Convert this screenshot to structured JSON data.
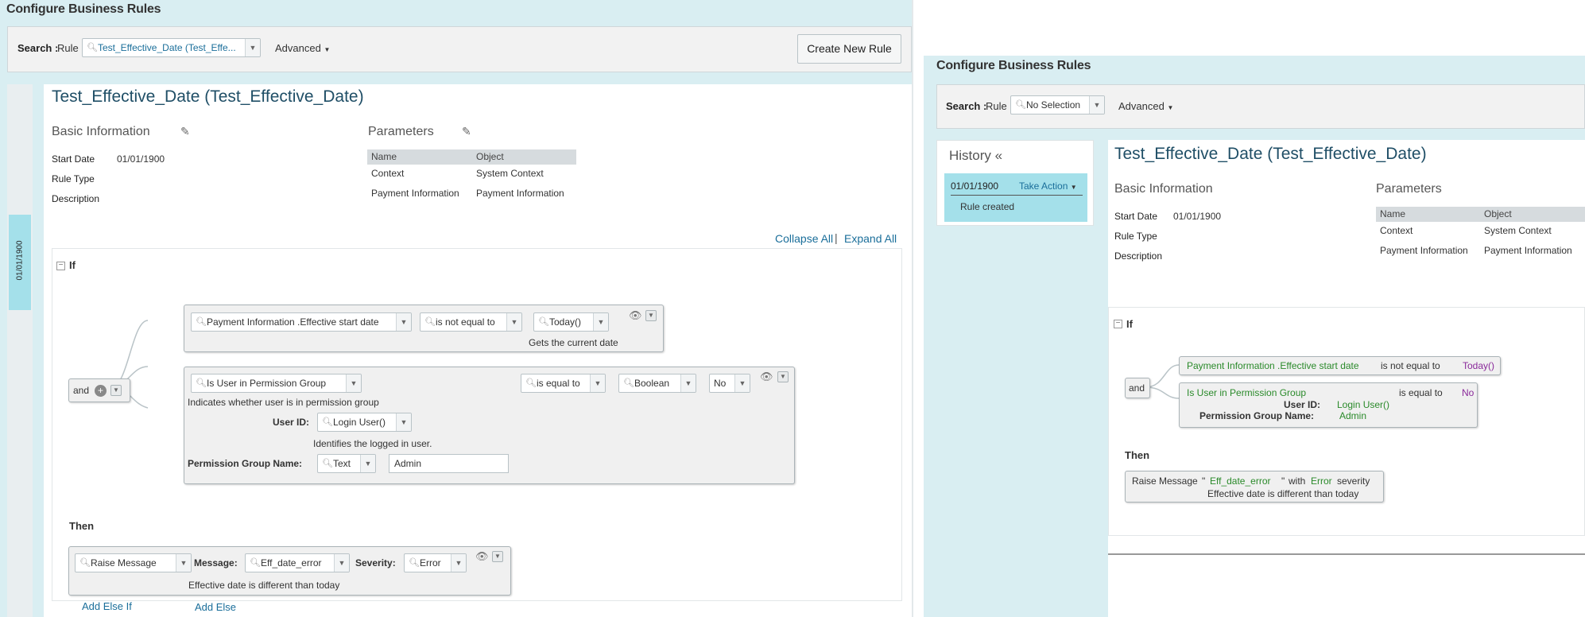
{
  "left": {
    "page_title": "Configure Business Rules",
    "search": {
      "label": "Search :",
      "sublabel": "Rule",
      "value": "Test_Effective_Date (Test_Effe...",
      "advanced": "Advanced",
      "create_button": "Create New Rule"
    },
    "history_date": "01/01/1900",
    "rule_title": "Test_Effective_Date (Test_Effective_Date)",
    "basic_info": {
      "heading": "Basic Information",
      "start_date_label": "Start Date",
      "start_date": "01/01/1900",
      "rule_type_label": "Rule Type",
      "description_label": "Description"
    },
    "parameters": {
      "heading": "Parameters",
      "col_name": "Name",
      "col_object": "Object",
      "rows": [
        {
          "name": "Context",
          "object": "System Context"
        },
        {
          "name": "Payment Information",
          "object": "Payment Information"
        }
      ]
    },
    "collapse_all": "Collapse All",
    "expand_all": "Expand All",
    "separator": "|",
    "if_label": "If",
    "and_label": "and",
    "cond1": {
      "field": "Payment Information .Effective start date",
      "operator": "is not equal to",
      "value": "Today()",
      "desc": "Gets the current date"
    },
    "cond2": {
      "field": "Is User in Permission Group",
      "desc": "Indicates whether user is in permission group",
      "operator": "is equal to",
      "type": "Boolean",
      "value": "No",
      "userid_label": "User ID:",
      "userid_value": "Login User()",
      "userid_desc": "Identifies the logged in user.",
      "pgn_label": "Permission Group Name:",
      "pgn_type": "Text",
      "pgn_value": "Admin"
    },
    "then_label": "Then",
    "action": {
      "type": "Raise Message",
      "message_label": "Message:",
      "message_value": "Eff_date_error",
      "severity_label": "Severity:",
      "severity_value": "Error",
      "desc": "Effective date is different than today"
    },
    "add_else_if": "Add Else If",
    "add_else": "Add Else"
  },
  "right": {
    "page_title": "Configure Business Rules",
    "search": {
      "label": "Search :",
      "sublabel": "Rule",
      "value": "No Selection",
      "advanced": "Advanced"
    },
    "history": {
      "title": "History «",
      "date": "01/01/1900",
      "take_action": "Take Action",
      "event": "Rule created"
    },
    "rule_title": "Test_Effective_Date (Test_Effective_Date)",
    "basic_info": {
      "heading": "Basic Information",
      "start_date_label": "Start Date",
      "start_date": "01/01/1900",
      "rule_type_label": "Rule Type",
      "description_label": "Description"
    },
    "parameters": {
      "heading": "Parameters",
      "col_name": "Name",
      "col_object": "Object",
      "rows": [
        {
          "name": "Context",
          "object": "System Context"
        },
        {
          "name": "Payment Information",
          "object": "Payment Information"
        }
      ]
    },
    "if_label": "If",
    "and_label": "and",
    "cond1": {
      "field": "Payment Information .Effective start date",
      "operator": "is not equal to",
      "value": "Today()"
    },
    "cond2": {
      "field": "Is User in Permission Group",
      "operator": "is equal to",
      "value": "No",
      "userid_label": "User ID:",
      "userid_value": "Login User()",
      "pgn_label": "Permission Group Name:",
      "pgn_value": "Admin"
    },
    "then_label": "Then",
    "action": {
      "type": "Raise Message",
      "quote_open": "\"",
      "message": "Eff_date_error",
      "quote_close": "\"",
      "with": "with",
      "severity": "Error",
      "severity_suffix": "severity",
      "desc": "Effective date is different than today"
    }
  },
  "colors": {
    "panel_bg": "#d9eef2",
    "link": "#1a6e9a",
    "title": "#1f4e66",
    "history_strip": "#a4e0ea",
    "green_text": "#2a8a2a",
    "purple_text": "#8a2a9a"
  }
}
